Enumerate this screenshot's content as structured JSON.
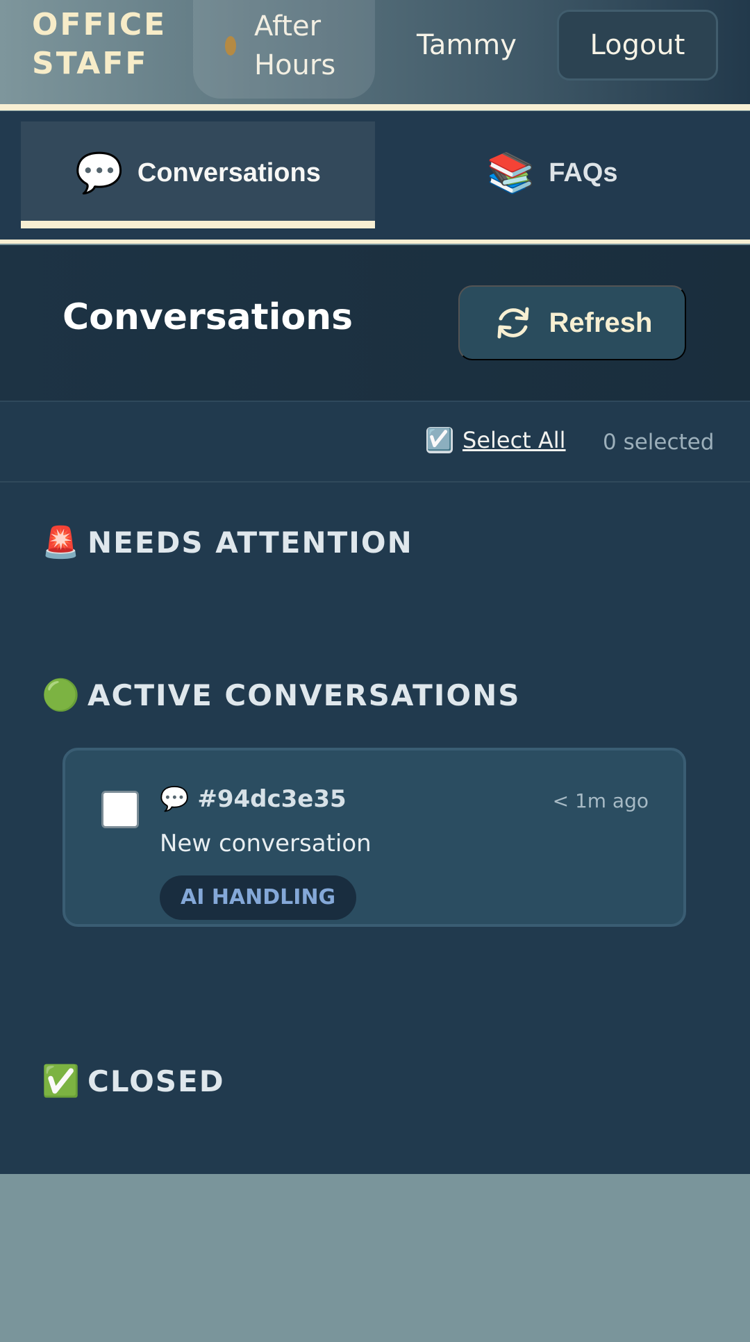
{
  "header": {
    "brand_line1": "OFFICE",
    "brand_line2": "STAFF",
    "status_line1": "After",
    "status_line2": "Hours",
    "user_name": "Tammy",
    "logout_label": "Logout"
  },
  "tabs": [
    {
      "icon": "speech-bubble-icon",
      "glyph": "💬",
      "label": "Conversations",
      "active": true
    },
    {
      "icon": "books-icon",
      "glyph": "📚",
      "label": "FAQs",
      "active": false
    }
  ],
  "page": {
    "title": "Conversations",
    "refresh_label": "Refresh",
    "select_all_label": "Select All",
    "select_all_glyph": "☑️",
    "selected_count": "0 selected"
  },
  "sections": {
    "needs_attention": {
      "glyph": "🚨",
      "label": "NEEDS ATTENTION"
    },
    "active": {
      "glyph": "🟢",
      "label": "ACTIVE CONVERSATIONS"
    },
    "closed": {
      "glyph": "✅",
      "label": "CLOSED"
    }
  },
  "conversations": [
    {
      "glyph": "💬",
      "id": "#94dc3e35",
      "time": "< 1m ago",
      "preview": "New conversation",
      "badge": "AI HANDLING"
    }
  ],
  "colors": {
    "accent_cream": "#f8efd3",
    "status_dot": "#b58a43",
    "badge_text": "#84a8d8"
  }
}
